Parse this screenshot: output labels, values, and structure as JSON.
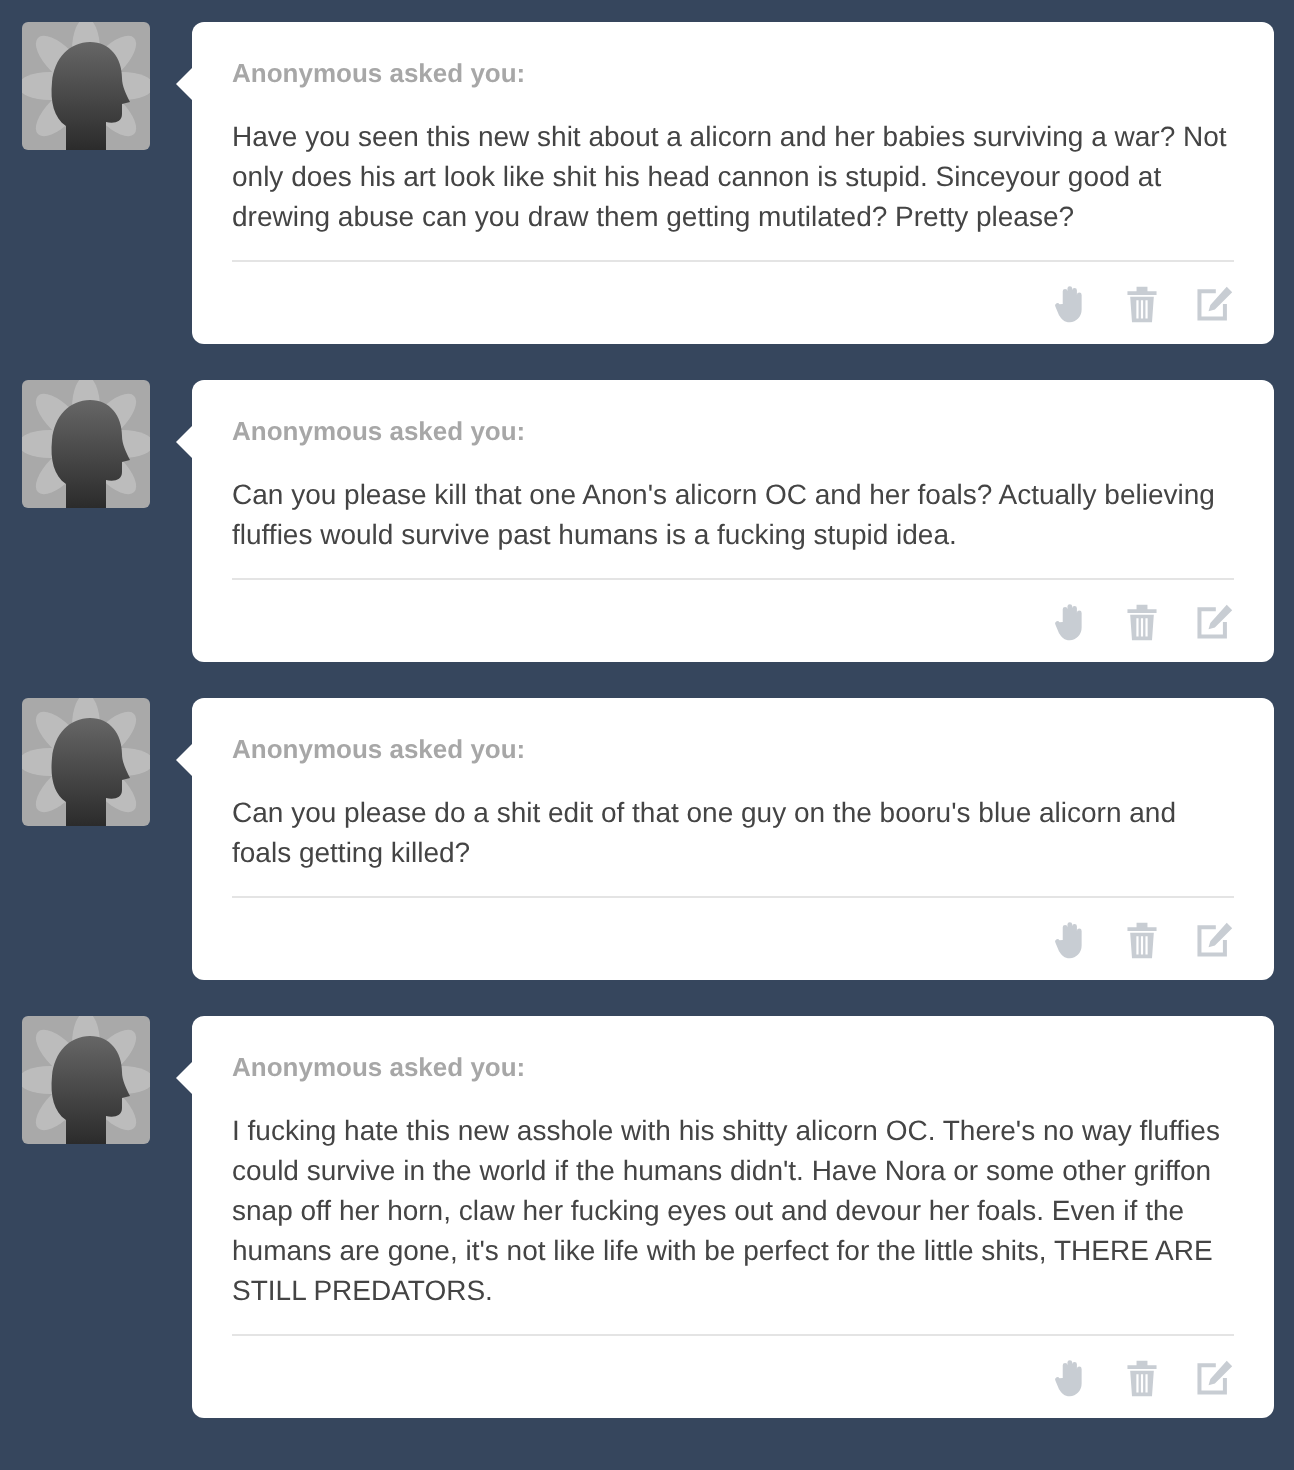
{
  "asks": [
    {
      "asker": "Anonymous asked you:",
      "question": "Have you seen this new shit about a alicorn and her babies surviving a war? Not only does his art look like shit his head cannon is stupid. Sinceyour good at drewing abuse can you draw them getting mutilated? Pretty please?"
    },
    {
      "asker": "Anonymous asked you:",
      "question": "Can you please kill that one Anon's alicorn OC and her foals? Actually believing fluffies would survive past humans is a fucking stupid idea."
    },
    {
      "asker": "Anonymous asked you:",
      "question": "Can you please do a shit edit of that one guy on the booru's blue alicorn and foals getting killed?"
    },
    {
      "asker": "Anonymous asked you:",
      "question": "I fucking hate this new asshole with his shitty alicorn OC. There's no way fluffies could survive in the world if the humans didn't. Have Nora or some other griffon snap off her horn, claw her fucking eyes out and devour her foals. Even if the humans are gone, it's not like life with be perfect for the little shits, THERE ARE STILL PREDATORS."
    }
  ]
}
